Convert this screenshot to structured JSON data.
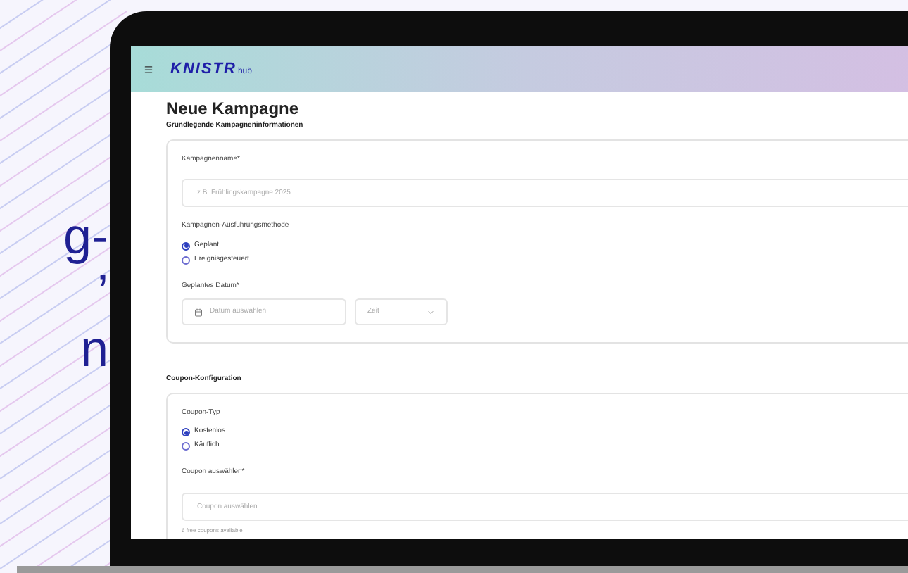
{
  "backdrop_text": [
    "g-",
    "’",
    "n"
  ],
  "app": {
    "logo": {
      "brand": "KNISTR",
      "suffix": "hub"
    },
    "title": "Neue Kampagne",
    "sections": [
      {
        "heading": "Grundlegende Kampagneninformationen",
        "fields": [
          {
            "kind": "text",
            "label": "Kampagnenname*",
            "placeholder": "z.B. Frühlingskampagne 2025"
          },
          {
            "kind": "radio",
            "label": "Kampagnen-Ausführungsmethode",
            "options": [
              {
                "label": "Geplant",
                "selected": true
              },
              {
                "label": "Ereignisgesteuert",
                "selected": false
              }
            ]
          },
          {
            "kind": "datetime",
            "label": "Geplantes Datum*",
            "date_placeholder": "Datum auswählen",
            "time_placeholder": "Zeit"
          }
        ]
      },
      {
        "heading": "Coupon-Konfiguration",
        "fields": [
          {
            "kind": "radio",
            "label": "Coupon-Typ",
            "options": [
              {
                "label": "Kostenlos",
                "selected": true
              },
              {
                "label": "Käuflich",
                "selected": false
              }
            ]
          },
          {
            "kind": "text",
            "label": "Coupon auswählen*",
            "placeholder": "Coupon auswählen",
            "helper": "6 free coupons available"
          }
        ]
      }
    ]
  }
}
